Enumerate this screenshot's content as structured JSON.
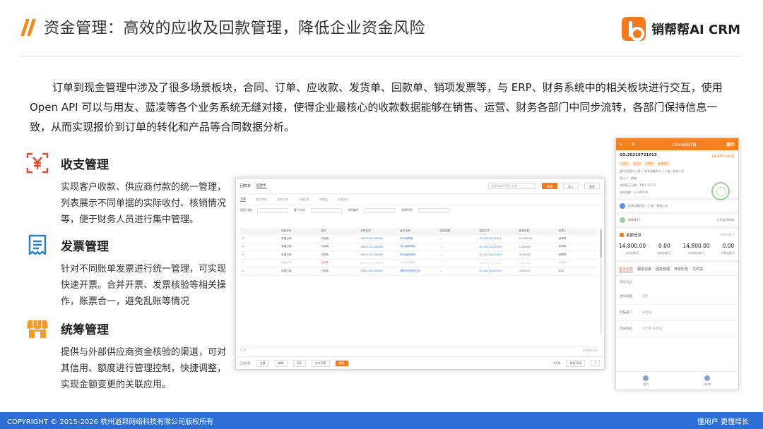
{
  "header": {
    "title": "资金管理：高效的应收及回款管理，降低企业资金风险",
    "logo_text": "销帮帮AI CRM",
    "accent_color": "#f08a1c"
  },
  "intro": "订单到现金管理中涉及了很多场景板块，合同、订单、应收款、发货单、回款单、销项发票等，与 ERP、财务系统中的相关板块进行交互，使用Open API 可以与用友、蓝凌等各个业务系统无缝对接，使得企业最核心的收款数据能够在销售、运营、财务各部门中同步流转，各部门保持信息一致，从而实现报价到订单的转化和产品等合同数据分析。",
  "features": [
    {
      "icon": "yen-scan-icon",
      "title": "收支管理",
      "desc": "实现客户收款、供应商付款的统一管理，列表展示不同单据的实际收付、核销情况等，便于财务人员进行集中管理。"
    },
    {
      "icon": "invoice-icon",
      "title": "发票管理",
      "desc": "针对不同账单发票进行统一管理，可实现快速开票。合并开票、发票核验等相关操作，账票合一，避免乱账等情况"
    },
    {
      "icon": "store-icon",
      "title": "统筹管理",
      "desc": "提供与外部供应商资金核验的渠道，可对其信用、额度进行管理控制，快捷调整，实现金额变更的关联应用。"
    }
  ],
  "desktop": {
    "app_title": "回款单",
    "top_tab": "回款单",
    "search_placeholder": "回款单编号/客户名称",
    "btn_new": "新建",
    "btn_import": "导入",
    "btn_more": "更多",
    "sub_tabs": [
      "全部",
      "我负责的",
      "我参与的",
      "下属负责",
      "待审批",
      "回款统计"
    ],
    "filters": [
      "回款日期",
      "客户名称",
      "合同编号",
      "创建时间"
    ],
    "columns": [
      "",
      "回款单号",
      "状态",
      "关联合同",
      "客户名称",
      "回款金额",
      "回款方式",
      "回款日期",
      "负责人"
    ],
    "rows": [
      [
        "☐",
        "单据日期",
        "已核销",
        "HKD.2021030801",
        "杭州销帮帮",
        "—",
        "SO.20210301001",
        "14,800.00",
        "销帮帮"
      ],
      [
        "☐",
        "单据日期",
        "已核销",
        "HKD.2021030802",
        "杭州逍邦网络",
        "—",
        "SO.20210301002",
        "1,800.00",
        "销帮帮"
      ],
      [
        "☐",
        "单据日期",
        "已核销",
        "HKD.2021030803",
        "杭州逍邦网络",
        "—",
        "SO.20210301003",
        "3,000.00",
        "销帮帮"
      ],
      [
        "☐",
        "单据日期",
        "已作废",
        "HKD.2021030804",
        "杭州逍邦网络",
        "—",
        "SO.20210301004",
        "3,000.00",
        "销帮帮"
      ],
      [
        "☐",
        "单据日期",
        "已核销",
        "HKD.2021030805",
        "腾讯科技有限公司",
        "—",
        "SO.20210301005",
        "3,000.00",
        "张华"
      ]
    ],
    "summary_left": "汇总",
    "summary_right": "14,800.00",
    "bottom_items": [
      "已选0项",
      "全量",
      "编辑",
      "打印",
      "合并开票",
      "删除",
      "共5条",
      "每页20条",
      "1"
    ]
  },
  "mobile": {
    "title": "CRM合同详情",
    "op": "操作",
    "contract_no": "SO.20210721013",
    "amount": "14,800.00元",
    "tags": [
      "已签约",
      "执行中",
      "已审批",
      "普通合同"
    ],
    "lines": [
      "合同名(客户公司)：佑享设备科技（上海）有限公司",
      "签订人：郝晓",
      "合同签订日期：2021-07-21",
      "合同金额：14,800.00"
    ],
    "customer": "佑享设备科技（上海）有限公司",
    "owner": "郝晓等4人",
    "stage": "已付款·再审批",
    "money_title": "金额信息",
    "money_more": "回款计划 >",
    "money": [
      {
        "v": "14,800.00",
        "k": "合同金额/元"
      },
      {
        "v": "0.00",
        "k": "收款金额/元"
      },
      {
        "v": "14,800.00",
        "k": "未收款金额/元"
      },
      {
        "v": "0.00",
        "k": "开票金额/元"
      }
    ],
    "tabs": [
      "基本信息",
      "跟进记录",
      "回款管理",
      "开票历史",
      "文件夹"
    ],
    "base_label": "基础信息",
    "fields": [
      {
        "k": "合同类型",
        "v": "续签"
      },
      {
        "k": "所属部门",
        "v": "研发部"
      },
      {
        "k": "合同状态",
        "v": "已付款·再审批"
      }
    ],
    "foot": [
      "跟进",
      "回款单"
    ]
  },
  "footer": {
    "left": "COPYRIGHT ©  2015-2026 杭州逍邦网络科技有限公司版权所有",
    "right": "懂用户  更懂增长",
    "color": "#2d6ed6"
  }
}
